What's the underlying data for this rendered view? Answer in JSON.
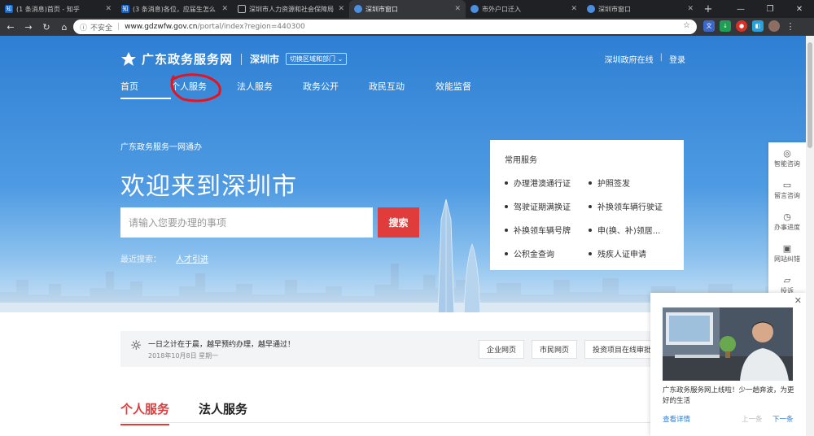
{
  "browser": {
    "tabs": [
      {
        "title": "(1 条消息)首页 - 知乎",
        "favicon": "zhihu-icon",
        "active": false
      },
      {
        "title": "(3 条消息)各位，应届生怎么",
        "favicon": "zhihu-icon",
        "active": false
      },
      {
        "title": "深圳市人力资源和社会保障局",
        "favicon": "document-icon",
        "active": false
      },
      {
        "title": "深圳市窗口",
        "favicon": "gd-logo-icon",
        "active": true
      },
      {
        "title": "市外户口迁入",
        "favicon": "gd-logo-icon",
        "active": false
      },
      {
        "title": "深圳市窗口",
        "favicon": "gd-logo-icon",
        "active": false
      }
    ],
    "new_tab": "+",
    "window_controls": [
      "—",
      "❐",
      "✕"
    ],
    "nav": {
      "back": "←",
      "forward": "→",
      "reload": "↻",
      "home": "⌂"
    },
    "address": {
      "security_label": "不安全",
      "host": "www.gdzwfw.gov.cn",
      "path": "/portal/index?region=440300"
    },
    "bookmark_star": "☆",
    "menu": "⋮"
  },
  "header": {
    "brand_name": "广东政务服务网",
    "city": "深圳市",
    "switch_label": "切换区域和部门 ⌄",
    "top_links": [
      "深圳政府在线",
      "登录"
    ],
    "nav": [
      "首页",
      "个人服务",
      "法人服务",
      "政务公开",
      "政民互动",
      "效能监督"
    ]
  },
  "hero": {
    "slogan": "广东政务服务一网通办",
    "welcome": "欢迎来到深圳市",
    "search_placeholder": "请输入您要办理的事项",
    "search_button": "搜索",
    "recent_label": "最近搜索：",
    "recent_keyword": "人才引进"
  },
  "common_services": {
    "title": "常用服务",
    "items": [
      "办理港澳通行证",
      "护照签发",
      "驾驶证期满换证",
      "补换领车辆行驶证",
      "补换领车辆号牌",
      "申(换、补)领居...",
      "公积金查询",
      "残疾人证申请"
    ]
  },
  "side_tools": [
    {
      "label": "智能咨询",
      "icon": "headset-icon",
      "glyph": "◎"
    },
    {
      "label": "留言咨询",
      "icon": "message-icon",
      "glyph": "▭"
    },
    {
      "label": "办事进度",
      "icon": "clock-icon",
      "glyph": "◷"
    },
    {
      "label": "网站纠错",
      "icon": "clipboard-icon",
      "glyph": "▣"
    },
    {
      "label": "投诉",
      "icon": "complaint-icon",
      "glyph": "▱"
    }
  ],
  "notice": {
    "message": "一日之计在于晨，越早预约办理，越早通过！",
    "date": "2018年10月8日 星期一",
    "links": [
      "企业网页",
      "市民网页",
      "投资项目在线审批"
    ]
  },
  "section_tabs": [
    "个人服务",
    "法人服务"
  ],
  "popup": {
    "close": "✕",
    "caption": "广东政务服务网上线啦！少一趟奔波，为更好的生活",
    "more": "查看详情",
    "prev": "上一条",
    "next": "下一条"
  },
  "colors": {
    "accent_red": "#e03c3c",
    "hero_blue": "#2e7fd3",
    "annotation_red": "#e5141e"
  }
}
